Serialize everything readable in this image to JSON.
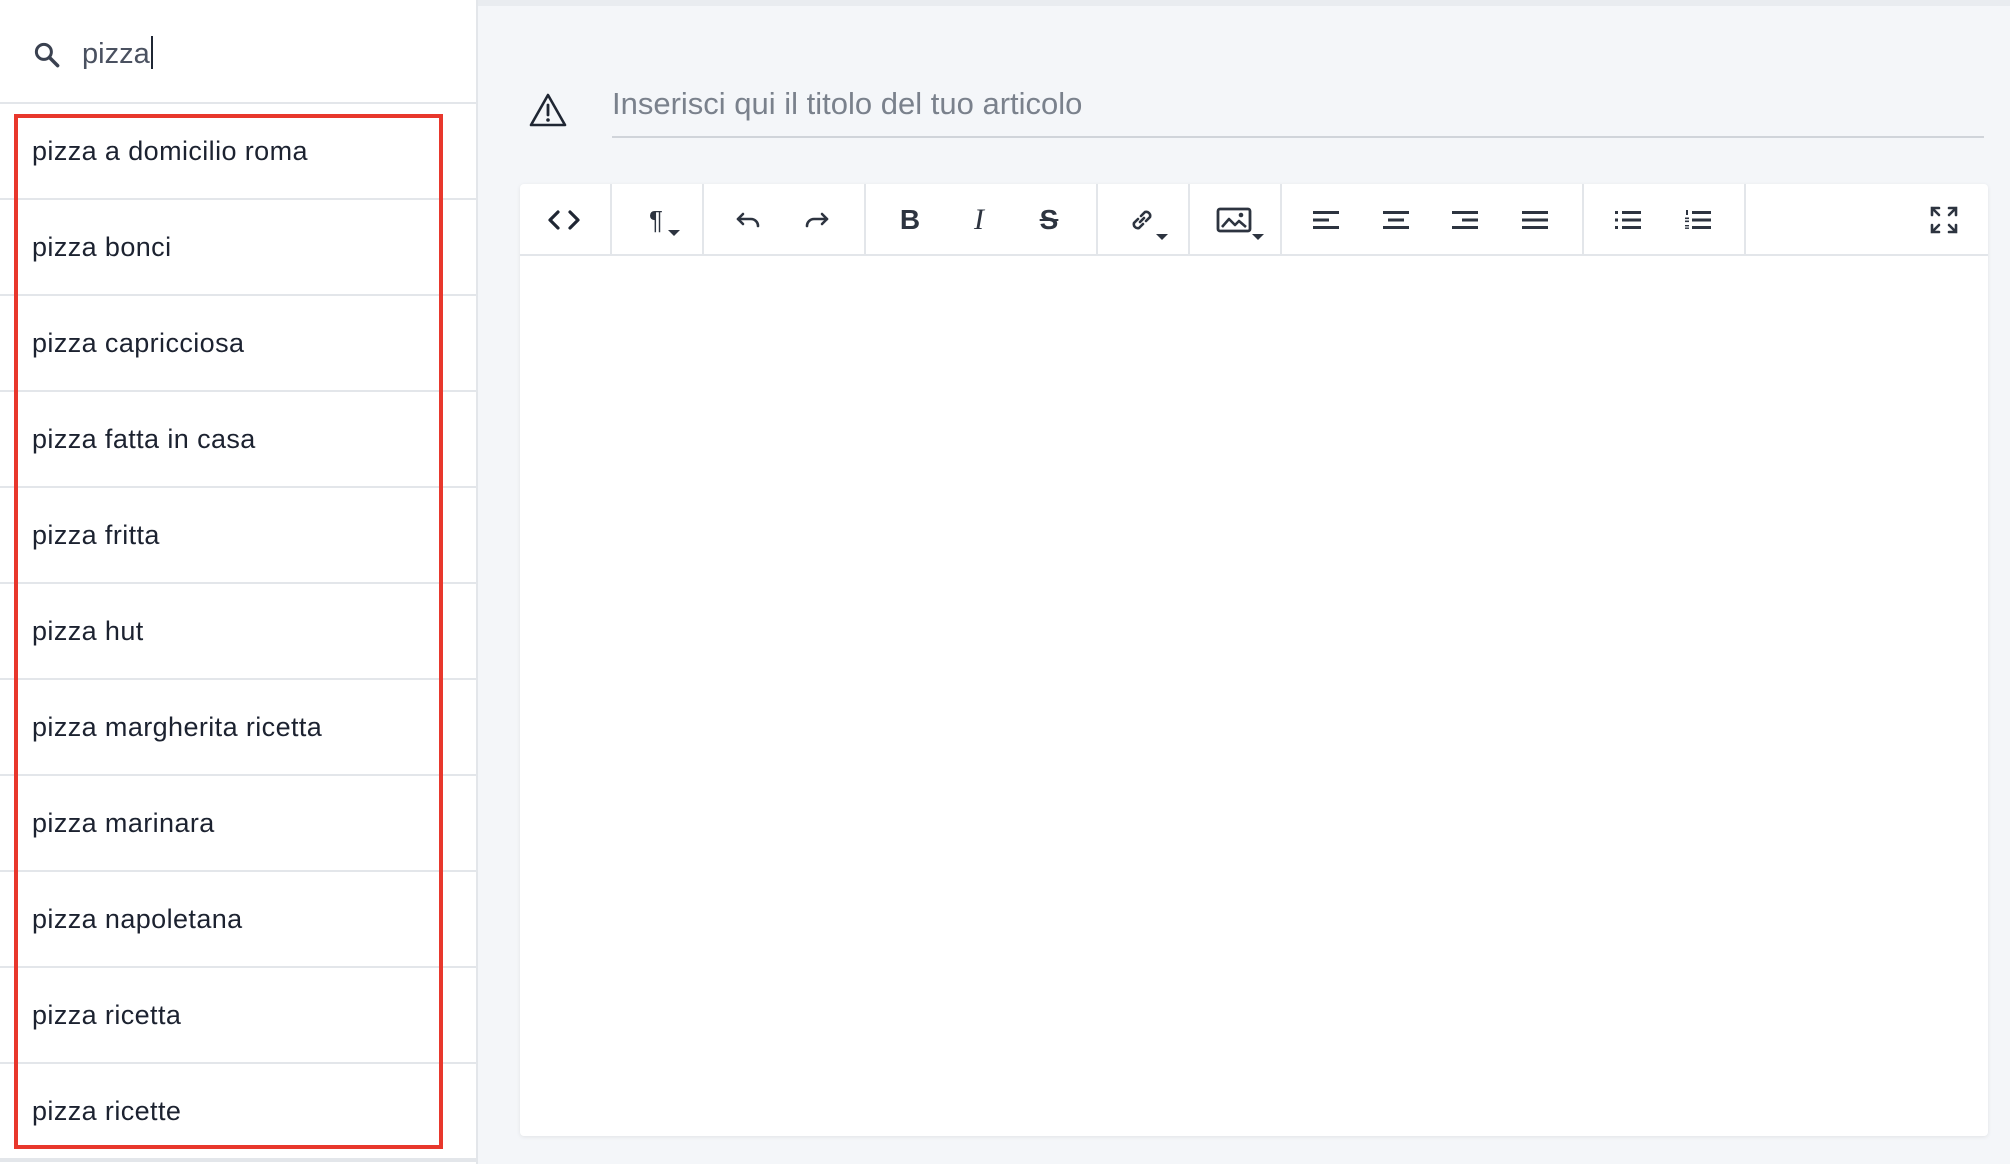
{
  "search": {
    "value": "pizza",
    "icon": "search-icon"
  },
  "suggestions": [
    "pizza a domicilio roma",
    "pizza bonci",
    "pizza capricciosa",
    "pizza fatta in casa",
    "pizza fritta",
    "pizza hut",
    "pizza margherita ricetta",
    "pizza marinara",
    "pizza napoletana",
    "pizza ricetta",
    "pizza ricette"
  ],
  "article": {
    "title_placeholder": "Inserisci qui il titolo del tuo articolo",
    "title_value": "",
    "warning_icon": "warning-triangle-icon"
  },
  "toolbar": {
    "code_view_icon": "code-view-icon",
    "paragraph_label": "¶",
    "undo_icon": "undo-icon",
    "redo_icon": "redo-icon",
    "bold_label": "B",
    "italic_label": "I",
    "strike_label": "S",
    "link_icon": "link-icon",
    "image_icon": "image-icon",
    "align_left_icon": "align-left-icon",
    "align_center_icon": "align-center-icon",
    "align_right_icon": "align-right-icon",
    "align_justify_icon": "align-justify-icon",
    "bullet_list_icon": "bullet-list-icon",
    "numbered_list_icon": "numbered-list-icon",
    "fullscreen_icon": "fullscreen-icon"
  },
  "colors": {
    "highlight": "#e8372c",
    "background": "#f4f6f9",
    "divider": "#e3e6ea",
    "text": "#1c2230"
  }
}
